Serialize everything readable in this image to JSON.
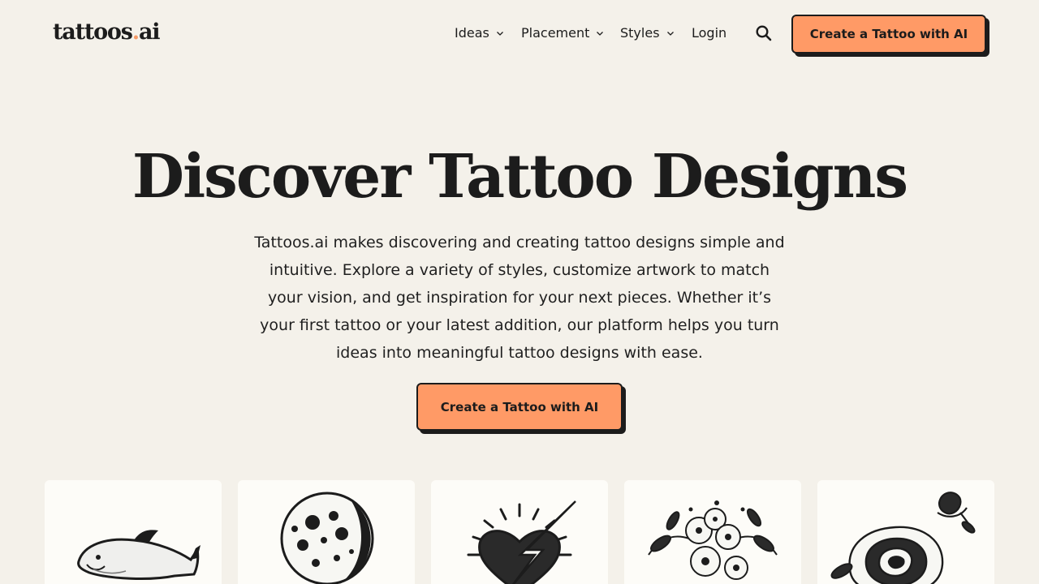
{
  "header": {
    "logo_main": "tattoos",
    "logo_dot": ".",
    "logo_tld": "ai",
    "nav": [
      {
        "label": "Ideas",
        "has_dropdown": true
      },
      {
        "label": "Placement",
        "has_dropdown": true
      },
      {
        "label": "Styles",
        "has_dropdown": true
      },
      {
        "label": "Login",
        "has_dropdown": false
      }
    ],
    "search_icon": "search-icon",
    "cta_label": "Create a Tattoo with AI"
  },
  "hero": {
    "title": "Discover Tattoo Designs",
    "description": "Tattoos.ai makes discovering and creating tattoo designs simple and intuitive. Explore a variety of styles, customize artwork to match your vision, and get inspiration for your next pieces. Whether it’s your first tattoo or your latest addition, our platform helps you turn ideas into meaningful tattoo designs with ease.",
    "cta_label": "Create a Tattoo with AI"
  },
  "gallery": [
    {
      "subject": "shark",
      "icon": "shark-tattoo-image"
    },
    {
      "subject": "moon",
      "icon": "moon-tattoo-image"
    },
    {
      "subject": "heart with lightning",
      "icon": "heart-lightning-tattoo-image"
    },
    {
      "subject": "flowers",
      "icon": "flower-tattoo-image"
    },
    {
      "subject": "rose",
      "icon": "rose-tattoo-image"
    }
  ],
  "colors": {
    "background": "#f4f1ea",
    "accent": "#ff9a66",
    "text": "#1c1c1c",
    "card": "#fdfcf8"
  }
}
